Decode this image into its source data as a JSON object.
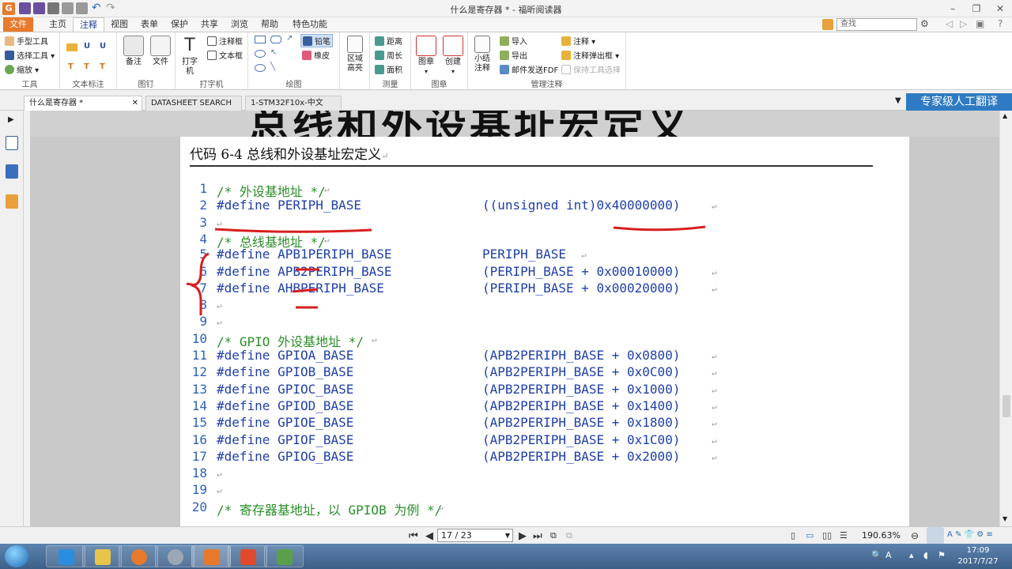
{
  "window": {
    "title": "什么是寄存器 * - 福昕阅读器",
    "logo": "G"
  },
  "ribbon_tabs": [
    "文件",
    "主页",
    "注释",
    "视图",
    "表单",
    "保护",
    "共享",
    "浏览",
    "帮助",
    "特色功能"
  ],
  "active_tab": "注释",
  "search": {
    "placeholder": "查找"
  },
  "ribbon": {
    "tools": {
      "items": [
        "手型工具",
        "选择工具",
        "缩放"
      ],
      "name": "工具"
    },
    "text_markup": {
      "name": "文本标注"
    },
    "pin": {
      "note": "备注",
      "file": "文件",
      "name": "图钉"
    },
    "typewriter": {
      "typewriter": "打字机",
      "callout": "注释框",
      "textbox": "文本框",
      "name": "打字机"
    },
    "drawing": {
      "pencil": "铅笔",
      "eraser": "橡皮",
      "name": "绘图"
    },
    "area": {
      "label": "区域高亮"
    },
    "measure": {
      "items": [
        "距离",
        "周长",
        "面积"
      ],
      "name": "测量"
    },
    "stamp": {
      "stamp": "图章",
      "create": "创建",
      "name": "图章"
    },
    "manage": {
      "summary": "小结注释",
      "import": "导入",
      "export": "导出",
      "email": "邮件发送FDF",
      "annotations": "注释",
      "popup": "注释弹出框",
      "keep_tool": "保持工具选择",
      "name": "管理注释"
    }
  },
  "doc_tabs": [
    "什么是寄存器 *",
    "DATASHEET SEARCH ...",
    "1-STM32F10x-中文参..."
  ],
  "translate_banner": "专家级人工翻译",
  "document": {
    "heading": "总线和外设基址宏定义",
    "code_title": "代码 6-4 总线和外设基址宏定义",
    "lines": [
      {
        "n": "1",
        "text": "/* 外设基地址 */",
        "comment": true,
        "value": ""
      },
      {
        "n": "2",
        "text": "#define PERIPH_BASE",
        "comment": false,
        "value": "((unsigned int)0x40000000)"
      },
      {
        "n": "3",
        "text": "",
        "comment": false,
        "value": ""
      },
      {
        "n": "4",
        "text": "/* 总线基地址 */",
        "comment": true,
        "value": ""
      },
      {
        "n": "5",
        "text": "#define APB1PERIPH_BASE",
        "comment": false,
        "value": "PERIPH_BASE"
      },
      {
        "n": "6",
        "text": "#define APB2PERIPH_BASE",
        "comment": false,
        "value": "(PERIPH_BASE + 0x00010000)"
      },
      {
        "n": "7",
        "text": "#define AHBPERIPH_BASE",
        "comment": false,
        "value": "(PERIPH_BASE + 0x00020000)"
      },
      {
        "n": "8",
        "text": "",
        "comment": false,
        "value": ""
      },
      {
        "n": "9",
        "text": "",
        "comment": false,
        "value": ""
      },
      {
        "n": "10",
        "text": "/* GPIO 外设基地址 */",
        "comment": true,
        "value": ""
      },
      {
        "n": "11",
        "text": "#define GPIOA_BASE",
        "comment": false,
        "value": "(APB2PERIPH_BASE + 0x0800)"
      },
      {
        "n": "12",
        "text": "#define GPIOB_BASE",
        "comment": false,
        "value": "(APB2PERIPH_BASE + 0x0C00)"
      },
      {
        "n": "13",
        "text": "#define GPIOC_BASE",
        "comment": false,
        "value": "(APB2PERIPH_BASE + 0x1000)"
      },
      {
        "n": "14",
        "text": "#define GPIOD_BASE",
        "comment": false,
        "value": "(APB2PERIPH_BASE + 0x1400)"
      },
      {
        "n": "15",
        "text": "#define GPIOE_BASE",
        "comment": false,
        "value": "(APB2PERIPH_BASE + 0x1800)"
      },
      {
        "n": "16",
        "text": "#define GPIOF_BASE",
        "comment": false,
        "value": "(APB2PERIPH_BASE + 0x1C00)"
      },
      {
        "n": "17",
        "text": "#define GPIOG_BASE",
        "comment": false,
        "value": "(APB2PERIPH_BASE + 0x2000)"
      },
      {
        "n": "18",
        "text": "",
        "comment": false,
        "value": ""
      },
      {
        "n": "19",
        "text": "",
        "comment": false,
        "value": ""
      },
      {
        "n": "20",
        "text": "/* 寄存器基地址，以 GPIOB 为例 */",
        "comment": true,
        "value": ""
      }
    ]
  },
  "status": {
    "page": "17 / 23",
    "zoom": "190.63%"
  },
  "clock": {
    "time": "17:09",
    "date": "2017/7/27"
  },
  "colors": {
    "accent": "#e8792b",
    "annotation": "#d81e1e",
    "code_blue": "#1f3fa8",
    "comment_green": "#2a8f2a"
  }
}
